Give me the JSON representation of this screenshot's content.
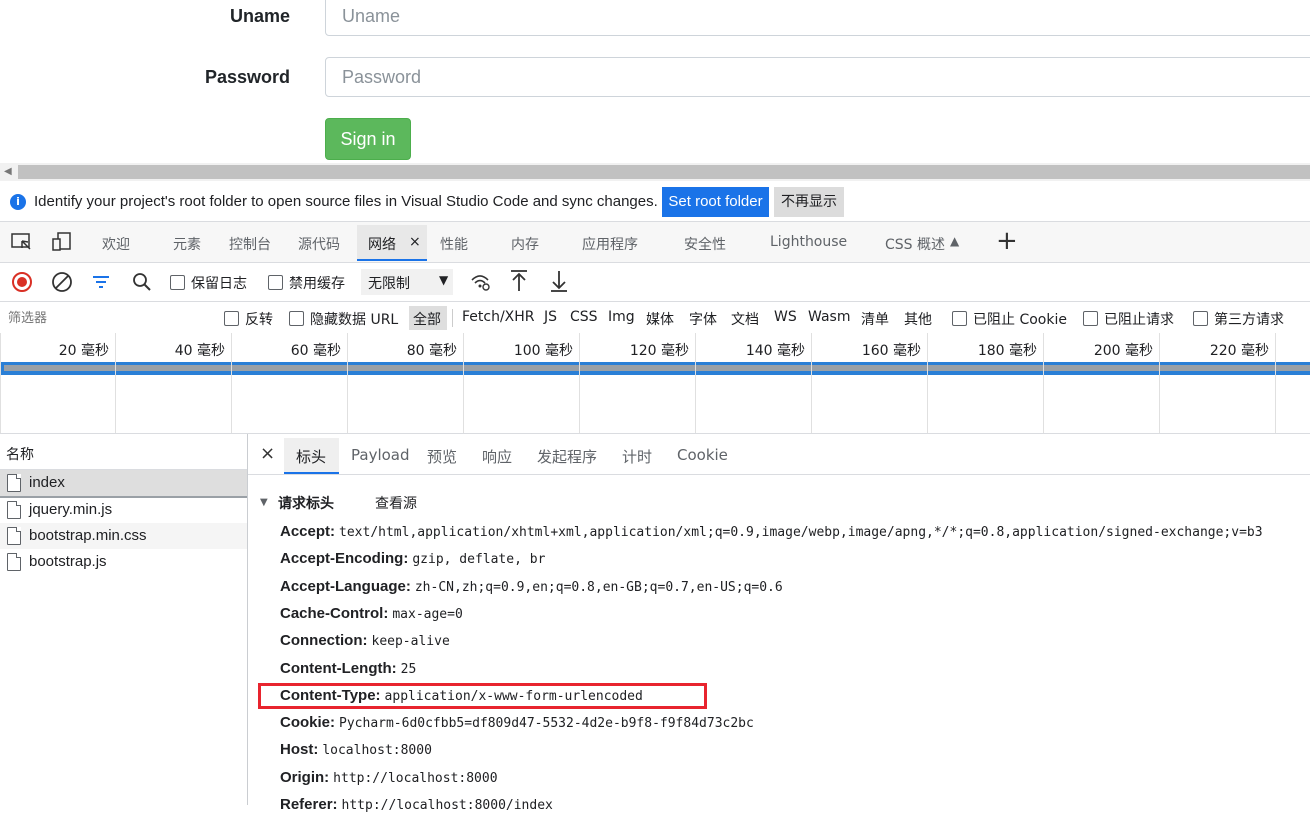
{
  "form": {
    "uname_label": "Uname",
    "uname_placeholder": "Uname",
    "password_label": "Password",
    "password_placeholder": "Password",
    "signin_label": "Sign in",
    "signin_color": "#5cb85c"
  },
  "infobar": {
    "text": "Identify your project's root folder to open source files in Visual Studio Code and sync changes.",
    "set_root_label": "Set root folder",
    "dismiss_label": "不再显示"
  },
  "tabs": {
    "welcome": "欢迎",
    "elements": "元素",
    "console": "控制台",
    "sources": "源代码",
    "network": "网络",
    "close": "×",
    "performance": "性能",
    "memory": "内存",
    "application": "应用程序",
    "security": "安全性",
    "lighthouse": "Lighthouse",
    "css_overview": "CSS 概述",
    "add": "+"
  },
  "toolbar": {
    "preserve_log": "保留日志",
    "disable_cache": "禁用缓存",
    "throttle": "无限制"
  },
  "filter": {
    "placeholder": "筛选器",
    "invert": "反转",
    "hide_data_urls": "隐藏数据 URL",
    "types": [
      "全部",
      "Fetch/XHR",
      "JS",
      "CSS",
      "Img",
      "媒体",
      "字体",
      "文档",
      "WS",
      "Wasm",
      "清单",
      "其他"
    ],
    "blocked_cookies": "已阻止 Cookie",
    "blocked_requests": "已阻止请求",
    "third_party": "第三方请求"
  },
  "timeline": {
    "ticks": [
      "20 毫秒",
      "40 毫秒",
      "60 毫秒",
      "80 毫秒",
      "100 毫秒",
      "120 毫秒",
      "140 毫秒",
      "160 毫秒",
      "180 毫秒",
      "200 毫秒",
      "220 毫秒"
    ]
  },
  "requests": {
    "header": "名称",
    "items": [
      "index",
      "jquery.min.js",
      "bootstrap.min.css",
      "bootstrap.js"
    ]
  },
  "detail": {
    "close": "×",
    "tabs": [
      "标头",
      "Payload",
      "预览",
      "响应",
      "发起程序",
      "计时",
      "Cookie"
    ],
    "section_title": "请求标头",
    "view_source": "查看源",
    "headers": [
      {
        "key": "Accept:",
        "value": "text/html,application/xhtml+xml,application/xml;q=0.9,image/webp,image/apng,*/*;q=0.8,application/signed-exchange;v=b3"
      },
      {
        "key": "Accept-Encoding:",
        "value": "gzip, deflate, br"
      },
      {
        "key": "Accept-Language:",
        "value": "zh-CN,zh;q=0.9,en;q=0.8,en-GB;q=0.7,en-US;q=0.6"
      },
      {
        "key": "Cache-Control:",
        "value": "max-age=0"
      },
      {
        "key": "Connection:",
        "value": "keep-alive"
      },
      {
        "key": "Content-Length:",
        "value": "25"
      },
      {
        "key": "Content-Type:",
        "value": "application/x-www-form-urlencoded"
      },
      {
        "key": "Cookie:",
        "value": "Pycharm-6d0cfbb5=df809d47-5532-4d2e-b9f8-f9f84d73c2bc"
      },
      {
        "key": "Host:",
        "value": "localhost:8000"
      },
      {
        "key": "Origin:",
        "value": "http://localhost:8000"
      },
      {
        "key": "Referer:",
        "value": "http://localhost:8000/index"
      }
    ],
    "highlight_color": "#e8242e"
  }
}
